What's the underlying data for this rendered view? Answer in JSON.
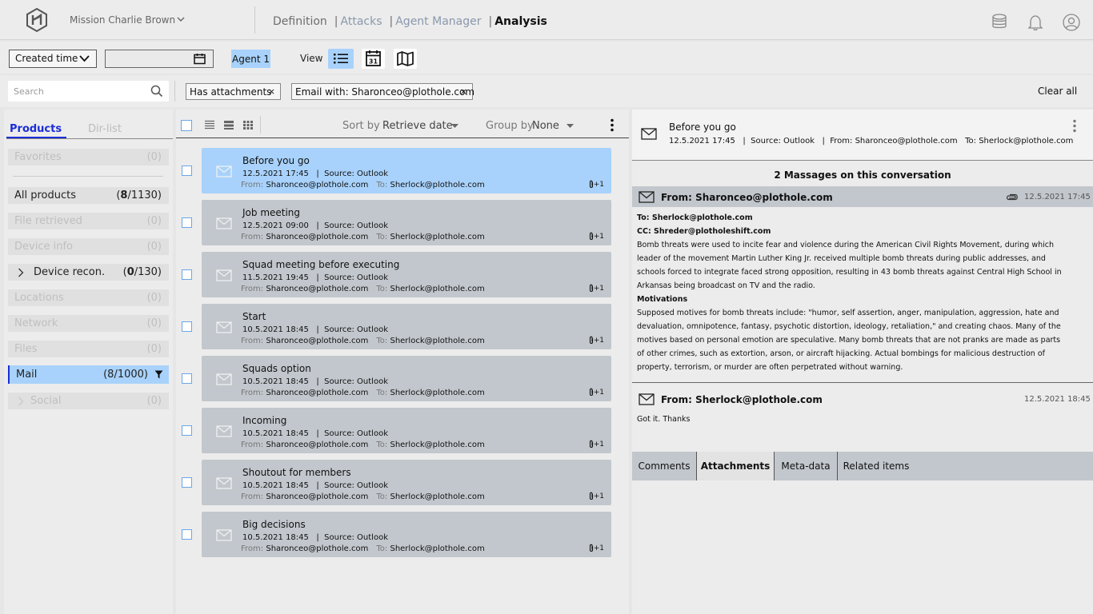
{
  "header": {
    "mission": "Mission Charlie Brown",
    "nav": [
      {
        "label": "Definition"
      },
      {
        "label": "Attacks"
      },
      {
        "label": "Agent Manager"
      },
      {
        "label": "Analysis"
      }
    ],
    "icons": [
      "logo-icon",
      "database-icon",
      "bell-icon",
      "user-icon"
    ]
  },
  "toolbar": {
    "sort_field": "Created time",
    "date_value": "",
    "agent": "Agent 1",
    "view_label": "View",
    "views": [
      "list-view-icon",
      "calendar-view-icon",
      "map-view-icon"
    ],
    "calendar_day": "31"
  },
  "filters": {
    "search_placeholder": "Search",
    "chips": [
      "Has attachments",
      "Email with: Sharonceo@plothole.com"
    ],
    "chip_close": "×",
    "clear_all": "Clear all"
  },
  "products": {
    "tabs": [
      "Products",
      "Dir-list"
    ],
    "items": [
      {
        "label": "Favorites",
        "count": "(0)"
      },
      {
        "label": "All products",
        "count_bold": "8",
        "count_rest": "/1130)"
      },
      {
        "label": "File retrieved",
        "count": "(0)"
      },
      {
        "label": "Device info",
        "count": "(0)"
      },
      {
        "label": "Device recon.",
        "count_bold": "0",
        "count_rest": "/130)"
      },
      {
        "label": "Locations",
        "count": "(0)"
      },
      {
        "label": "Network",
        "count": "(0)"
      },
      {
        "label": "Files",
        "count": "(0)"
      },
      {
        "label": "Mail",
        "count": "(8/1000)"
      },
      {
        "label": "Social",
        "count": "(0)"
      }
    ],
    "open_paren": "("
  },
  "list": {
    "sort_label": "Sort by",
    "sort_value": "Retrieve date",
    "group_label": "Group by",
    "group_value": "None",
    "from_key": "From:",
    "to_key": "To:",
    "attach_count": "+1",
    "emails": [
      {
        "title": "Before you go",
        "date": "12.5.2021 17:45",
        "source": "Source: Outlook",
        "from": "Sharonceo@plothole.com",
        "to": "Sherlock@plothole.com"
      },
      {
        "title": "Job meeting",
        "date": "12.5.2021 09:00",
        "source": "Source: Outlook",
        "from": "Sharonceo@plothole.com",
        "to": "Sherlock@plothole.com"
      },
      {
        "title": "Squad meeting before executing",
        "date": "11.5.2021 19:45",
        "source": "Source: Outlook",
        "from": "Sharonceo@plothole.com",
        "to": "Sherlock@plothole.com"
      },
      {
        "title": "Start",
        "date": "10.5.2021 18:45",
        "source": "Source: Outlook",
        "from": "Sharonceo@plothole.com",
        "to": "Sherlock@plothole.com"
      },
      {
        "title": "Squads option",
        "date": "10.5.2021 18:45",
        "source": "Source: Outlook",
        "from": "Sharonceo@plothole.com",
        "to": "Sherlock@plothole.com"
      },
      {
        "title": "Incoming",
        "date": "10.5.2021 18:45",
        "source": "Source: Outlook",
        "from": "Sharonceo@plothole.com",
        "to": "Sherlock@plothole.com"
      },
      {
        "title": "Shoutout for members",
        "date": "10.5.2021 18:45",
        "source": "Source: Outlook",
        "from": "Sharonceo@plothole.com",
        "to": "Sherlock@plothole.com"
      },
      {
        "title": "Big decisions",
        "date": "10.5.2021 18:45",
        "source": "Source: Outlook",
        "from": "Sharonceo@plothole.com",
        "to": "Sherlock@plothole.com"
      }
    ]
  },
  "detail": {
    "title": "Before you go",
    "meta": "12.5.2021 17:45   |  Source: Outlook   |  From: Sharonceo@plothole.com   To: Sherlock@plothole.com",
    "conversation_count": "2 Massages on this conversation",
    "messages": [
      {
        "from": "From: Sharonceo@plothole.com",
        "date": "12.5.2021 17:45",
        "to": "To: Sherlock@plothole.com",
        "cc": "CC: Shreder@plotholeshift.com",
        "body1": "Bomb threats were used to incite fear and violence during the American Civil Rights Movement, during which leader of the movement Martin Luther King Jr. received multiple bomb threats during public addresses, and schools forced to integrate faced strong opposition, resulting in 43 bomb threats against Central High School in Arkansas being broadcast on TV and the radio.",
        "heading": "Motivations",
        "body2": "Supposed motives for bomb threats include: \"humor, self assertion, anger, manipulation, aggression, hate and devaluation, omnipotence, fantasy, psychotic distortion, ideology, retaliation,\" and creating chaos. Many of the motives based on personal emotion are speculative. Many bomb threats that are not pranks are made as parts of other crimes, such as extortion, arson, or aircraft hijacking. Actual bombings for malicious destruction of property, terrorism, or murder are often perpetrated without warning."
      },
      {
        "from": "From: Sherlock@plothole.com",
        "date": "12.5.2021 18:45",
        "body": "Got it. Thanks"
      }
    ],
    "tabs": [
      "Comments",
      "Attachments",
      "Meta-data",
      "Related items"
    ]
  },
  "colors": {
    "accent": "#1a2dd6",
    "selected": "#a8d2fb",
    "card": "#c2c7cd"
  }
}
